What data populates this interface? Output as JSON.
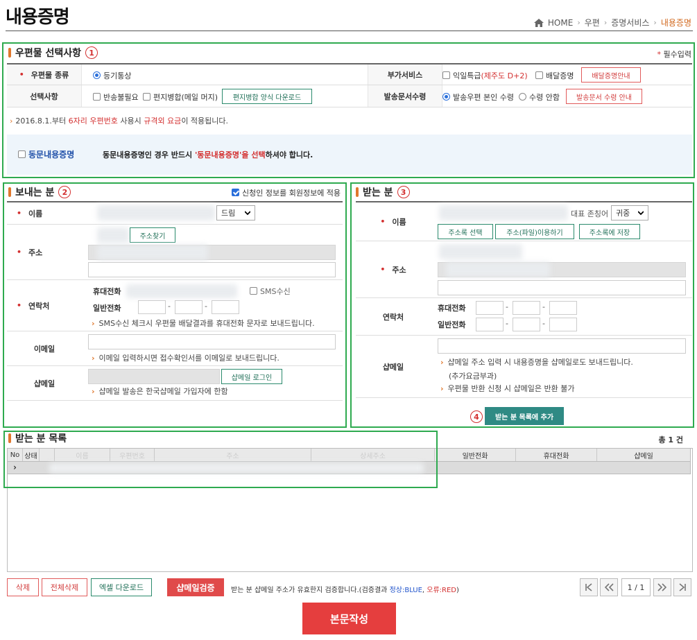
{
  "page": {
    "title": "내용증명",
    "breadcrumb": [
      "HOME",
      "우편",
      "증명서비스",
      "내용증명"
    ]
  },
  "section1": {
    "title": "우편물 선택사항",
    "marker": "1",
    "required_mark": "*",
    "required_label": "필수입력",
    "mail_type_label": "우편물 종류",
    "mail_type_option": "등기통상",
    "extra_service_label": "부가서비스",
    "extra_next_day": "익일특급",
    "extra_next_day_note": "(제주도 D+2)",
    "extra_delivery_cert": "배달증명",
    "delivery_guide_btn": "배달증명안내",
    "options_label": "선택사항",
    "option_return_unneeded": "반송불필요",
    "option_merge": "편지병합(메일 머지)",
    "merge_download_btn": "편지병합 양식 다운로드",
    "doc_receive_label": "발송문서수령",
    "doc_receive_self": "발송우편 본인 수령",
    "doc_receive_none": "수령 안함",
    "doc_receive_guide_btn": "발송문서 수령 안내",
    "notice_prefix": "2016.8.1.부터 ",
    "notice_red1": "6자리 우편번호",
    "notice_mid": " 사용시 ",
    "notice_red2": "규격외 요금",
    "notice_suffix": "이 적용됩니다.",
    "joint_label": "동문내용증명",
    "joint_desc_prefix": "동문내용증명인 경우 반드시 ",
    "joint_desc_red": "'동문내용증명'을 선택",
    "joint_desc_suffix": "하셔야 합니다."
  },
  "sender": {
    "title": "보내는 분",
    "marker": "2",
    "apply_member_info": "신청인 정보를 회원정보에 적용",
    "name_label": "이름",
    "honorific_select": "드림",
    "address_label": "주소",
    "address_search_btn": "주소찾기",
    "contact_label": "연락처",
    "mobile_label": "휴대전화",
    "sms_label": "SMS수신",
    "phone_label": "일반전화",
    "sms_note": "SMS수신 체크시 우편물 배달결과를 휴대전화 문자로 보내드립니다.",
    "email_label": "이메일",
    "email_note": "이메일 입력하시면 접수확인서를 이메일로 보내드립니다.",
    "shmail_label": "샵메일",
    "shmail_login_btn": "샵메일 로그인",
    "shmail_note": "샵메일 발송은 한국샵메일 가입자에 한함"
  },
  "receiver": {
    "title": "받는 분",
    "marker": "3",
    "name_label": "이름",
    "honorific_label": "대표 존칭어",
    "honorific_select": "귀중",
    "address_book_btn": "주소록 선택",
    "address_file_btn": "주소(파일)이용하기",
    "address_save_btn": "주소록에 저장",
    "address_label": "주소",
    "contact_label": "연락처",
    "mobile_label": "휴대전화",
    "phone_label": "일반전화",
    "shmail_label": "샵메일",
    "shmail_note1": "샵메일 주소 입력 시 내용증명을 샵메일로도 보내드립니다.",
    "shmail_note2": "(추가요금부과)",
    "shmail_note3": "우편물 반환 신청 시 샵메일은 반환 불가",
    "add_marker": "4",
    "add_btn": "받는 분 목록에 추가"
  },
  "list": {
    "title": "받는 분 목록",
    "total": "총 1 건",
    "headers": [
      "No",
      "상태",
      "",
      "이름",
      "우편번호",
      "주소",
      "상세주소",
      "일반전화",
      "휴대전화",
      "샵메일"
    ]
  },
  "footer": {
    "delete_btn": "삭제",
    "delete_all_btn": "전체삭제",
    "excel_btn": "엑셀 다운로드",
    "shmail_verify_btn": "샵메일검증",
    "verify_note_prefix": "받는 분 샵메일 주소가 유효한지 검증합니다.(검증결과 ",
    "verify_ok": "정상:BLUE",
    "verify_sep": ", ",
    "verify_err": "오류:RED",
    "verify_note_suffix": ")",
    "page_indicator": "1 / 1",
    "write_btn": "본문작성"
  }
}
